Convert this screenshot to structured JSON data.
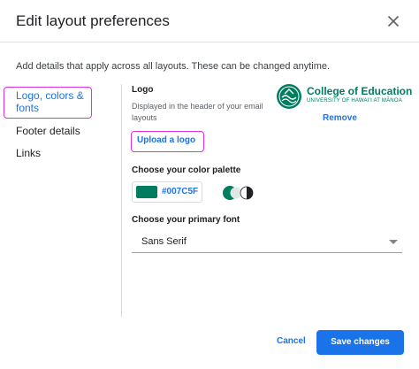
{
  "dialog": {
    "title": "Edit layout preferences",
    "description": "Add details that apply across all layouts. These can be changed anytime."
  },
  "nav": {
    "items": [
      {
        "label": "Logo, colors & fonts",
        "active": true
      },
      {
        "label": "Footer details",
        "active": false
      },
      {
        "label": "Links",
        "active": false
      }
    ]
  },
  "logo_section": {
    "label": "Logo",
    "help": "Displayed in the header of your email layouts",
    "upload_label": "Upload a logo",
    "remove_label": "Remove",
    "logo": {
      "name": "College of Education",
      "subtitle": "UNIVERSITY OF HAWAIʻI AT MĀNOA",
      "color": "#007C5F"
    }
  },
  "palette_section": {
    "label": "Choose your color palette",
    "color_hex": "#007C5F",
    "swatch_color": "#007C5F",
    "theme_icon": "contrast-toggle-icon"
  },
  "font_section": {
    "label": "Choose your primary font",
    "selected": "Sans Serif"
  },
  "footer": {
    "cancel_label": "Cancel",
    "save_label": "Save changes"
  },
  "colors": {
    "accent": "#1A73E8",
    "highlight": "#E033E0",
    "brand": "#007C5F"
  }
}
